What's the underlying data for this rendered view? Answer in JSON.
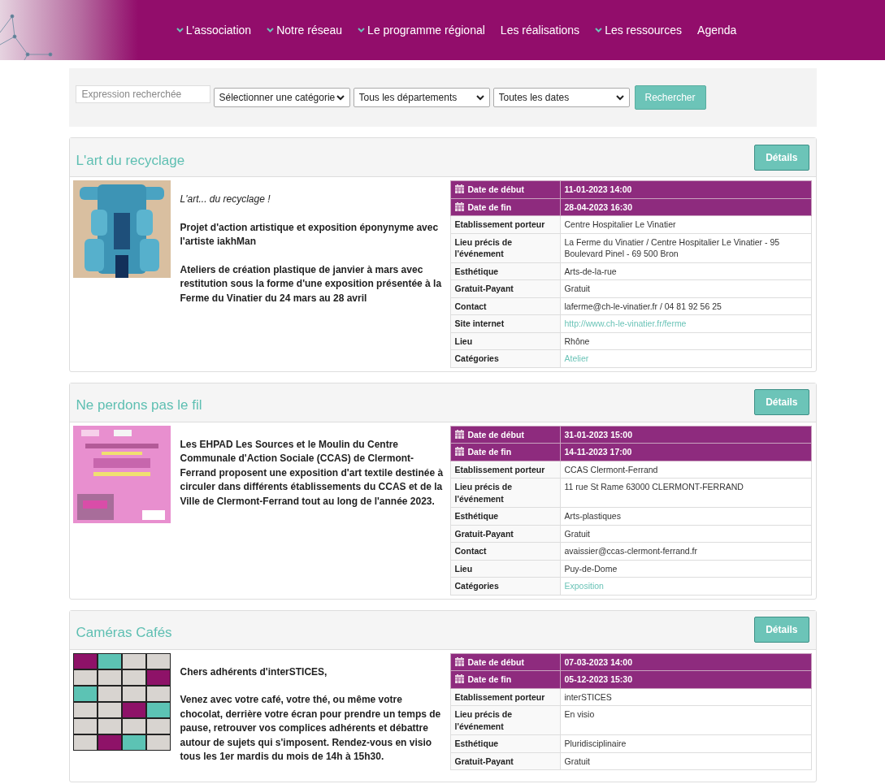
{
  "nav": [
    {
      "label": "L'association",
      "dropdown": true
    },
    {
      "label": "Notre réseau",
      "dropdown": true
    },
    {
      "label": "Le programme régional",
      "dropdown": true
    },
    {
      "label": "Les réalisations",
      "dropdown": false
    },
    {
      "label": "Les ressources",
      "dropdown": true
    },
    {
      "label": "Agenda",
      "dropdown": false
    }
  ],
  "search": {
    "placeholder": "Expression recherchée",
    "selects": [
      "Sélectionner une catégorie",
      "Tous les départements",
      "Toutes les dates"
    ],
    "button": "Rechercher"
  },
  "events": [
    {
      "title": "L'art du recyclage",
      "button": "Détails",
      "paragraphs": [
        {
          "kind": "italic",
          "text": "L'art... du recyclage !"
        },
        {
          "kind": "bold",
          "text": "Projet d'action artistique et exposition éponynyme avec l'artiste iakhMan"
        },
        {
          "kind": "bold",
          "text": "Ateliers de création plastique de janvier à mars avec restitution sous la forme d'une exposition présentée à la Ferme du Vinatier du 24 mars au 28 avril"
        }
      ],
      "details": [
        {
          "kind": "date",
          "label": "Date de début",
          "value": "11-01-2023 14:00"
        },
        {
          "kind": "date",
          "label": "Date de fin",
          "value": "28-04-2023 16:30"
        },
        {
          "kind": "text",
          "label": "Etablissement porteur",
          "value": "Centre Hospitalier Le Vinatier"
        },
        {
          "kind": "text",
          "label": "Lieu précis de l'événement",
          "value": "La Ferme du Vinatier / Centre Hospitalier Le Vinatier - 95 Boulevard Pinel - 69 500 Bron"
        },
        {
          "kind": "text",
          "label": "Esthétique",
          "value": "Arts-de-la-rue"
        },
        {
          "kind": "text",
          "label": "Gratuit-Payant",
          "value": "Gratuit"
        },
        {
          "kind": "text",
          "label": "Contact",
          "value": "laferme@ch-le-vinatier.fr / 04 81 92 56 25"
        },
        {
          "kind": "link",
          "label": "Site internet",
          "value": "http://www.ch-le-vinatier.fr/ferme"
        },
        {
          "kind": "text",
          "label": "Lieu",
          "value": "Rhône"
        },
        {
          "kind": "link",
          "label": "Catégories",
          "value": "Atelier"
        }
      ]
    },
    {
      "title": "Ne perdons pas le fil",
      "button": "Détails",
      "paragraphs": [
        {
          "kind": "bold",
          "text": "Les EHPAD Les Sources et le Moulin du Centre Communale d'Action Sociale (CCAS) de Clermont-Ferrand proposent une exposition d'art textile destinée à circuler dans différents établissements du CCAS et de la Ville de Clermont-Ferrand tout au long de l'année 2023."
        }
      ],
      "details": [
        {
          "kind": "date",
          "label": "Date de début",
          "value": "31-01-2023 15:00"
        },
        {
          "kind": "date",
          "label": "Date de fin",
          "value": "14-11-2023 17:00"
        },
        {
          "kind": "text",
          "label": "Etablissement porteur",
          "value": "CCAS Clermont-Ferrand"
        },
        {
          "kind": "text",
          "label": "Lieu précis de l'événement",
          "value": "11 rue St Rame 63000 CLERMONT-FERRAND"
        },
        {
          "kind": "text",
          "label": "Esthétique",
          "value": "Arts-plastiques"
        },
        {
          "kind": "text",
          "label": "Gratuit-Payant",
          "value": "Gratuit"
        },
        {
          "kind": "text",
          "label": "Contact",
          "value": "avaissier@ccas-clermont-ferrand.fr"
        },
        {
          "kind": "text",
          "label": "Lieu",
          "value": "Puy-de-Dome"
        },
        {
          "kind": "link",
          "label": "Catégories",
          "value": "Exposition"
        }
      ]
    },
    {
      "title": "Caméras Cafés",
      "button": "Détails",
      "paragraphs": [
        {
          "kind": "bold",
          "text": "Chers adhérents d'interSTICES,"
        },
        {
          "kind": "bold",
          "text": "Venez avec votre café, votre thé, ou même votre chocolat, derrière votre écran pour prendre un temps de pause, retrouver vos complices adhérents et débattre autour de sujets qui s'imposent. Rendez-vous en visio tous les 1er mardis du mois de 14h à 15h30."
        }
      ],
      "details": [
        {
          "kind": "date",
          "label": "Date de début",
          "value": "07-03-2023 14:00"
        },
        {
          "kind": "date",
          "label": "Date de fin",
          "value": "05-12-2023 15:30"
        },
        {
          "kind": "text",
          "label": "Etablissement porteur",
          "value": "interSTICES"
        },
        {
          "kind": "text",
          "label": "Lieu précis de l'événement",
          "value": "En visio"
        },
        {
          "kind": "text",
          "label": "Esthétique",
          "value": "Pluridisciplinaire"
        },
        {
          "kind": "text",
          "label": "Gratuit-Payant",
          "value": "Gratuit"
        }
      ]
    }
  ]
}
